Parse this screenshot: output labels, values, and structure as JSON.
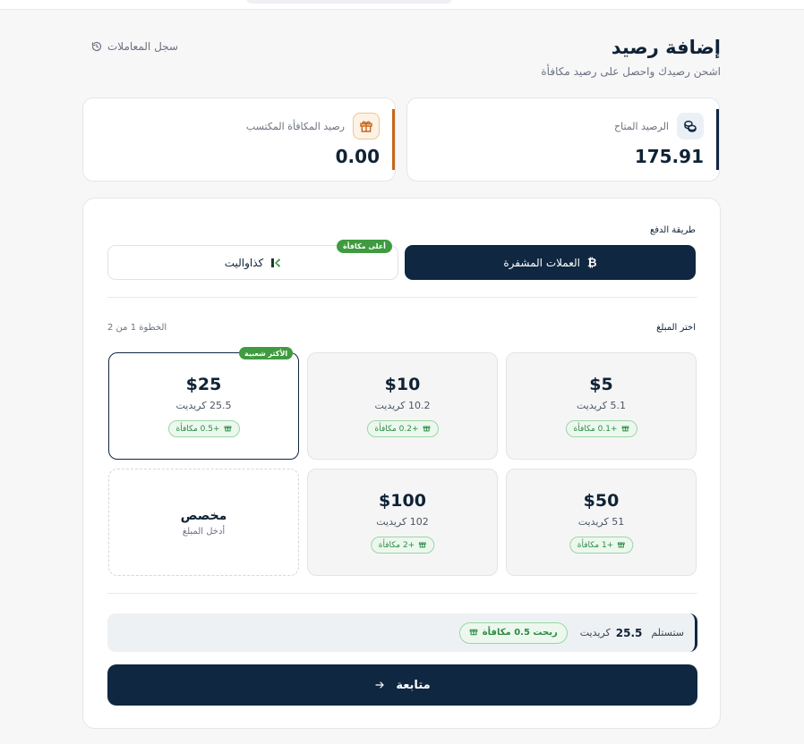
{
  "header": {
    "title": "إضافة رصيد",
    "subtitle": "اشحن رصيدك واحصل على رصيد مكافأة",
    "history_label": "سجل المعاملات"
  },
  "balances": {
    "available": {
      "label": "الرصيد المتاح",
      "value": "175.91",
      "accent": "#0f2740"
    },
    "bonus": {
      "label": "رصيد المكافأة المكتسب",
      "value": "0.00",
      "accent": "#c7671a"
    }
  },
  "payment": {
    "label": "طريقة الدفع",
    "methods": [
      {
        "label": "العملات المشفرة",
        "icon": "bitcoin-icon",
        "selected": true
      },
      {
        "label": "كذاواليت",
        "icon": "kazawallet-logo-icon",
        "selected": false,
        "badge": "أعلى مكافأة"
      }
    ]
  },
  "amounts": {
    "label": "اختر المبلغ",
    "step": "الخطوة 1 من 2",
    "options": [
      {
        "price": "$5",
        "credits": "5.1 كريديت",
        "bonus": "+0.1 مكافأة"
      },
      {
        "price": "$10",
        "credits": "10.2 كريديت",
        "bonus": "+0.2 مكافأة"
      },
      {
        "price": "$25",
        "credits": "25.5 كريديت",
        "bonus": "+0.5 مكافأة",
        "badge": "الأكثر شعبية",
        "selected": true
      },
      {
        "price": "$50",
        "credits": "51 كريديت",
        "bonus": "+1 مكافأة"
      },
      {
        "price": "$100",
        "credits": "102 كريديت",
        "bonus": "+2 مكافأة"
      }
    ],
    "custom": {
      "title": "مخصص",
      "subtitle": "أدخل المبلغ"
    }
  },
  "summary": {
    "receive_label": "ستستلم",
    "amount": "25.5",
    "unit": "كريديت",
    "earned": "ربحت 0.5 مكافأة"
  },
  "continue_label": "متابعة",
  "colors": {
    "primary": "#0f2740",
    "success": "#3f9b3f",
    "bonus_accent": "#c7671a"
  }
}
